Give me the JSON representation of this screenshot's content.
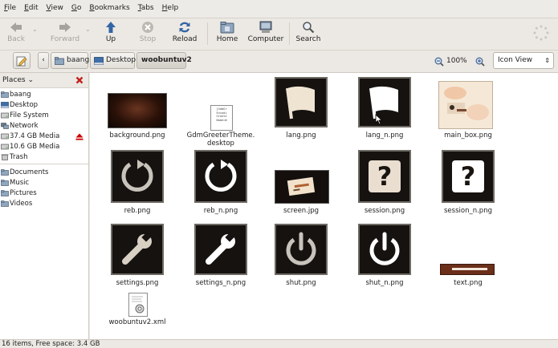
{
  "menubar": [
    {
      "label": "File",
      "key": "F",
      "rest": "ile"
    },
    {
      "label": "Edit",
      "key": "E",
      "rest": "dit"
    },
    {
      "label": "View",
      "key": "V",
      "rest": "iew"
    },
    {
      "label": "Go",
      "key": "G",
      "rest": "o"
    },
    {
      "label": "Bookmarks",
      "key": "B",
      "rest": "ookmarks"
    },
    {
      "label": "Tabs",
      "key": "T",
      "rest": "abs"
    },
    {
      "label": "Help",
      "key": "H",
      "rest": "elp"
    }
  ],
  "toolbar": {
    "back": "Back",
    "forward": "Forward",
    "up": "Up",
    "stop": "Stop",
    "reload": "Reload",
    "home": "Home",
    "computer": "Computer",
    "search": "Search"
  },
  "location": {
    "crumbs": [
      "baang",
      "Desktop",
      "woobuntuv2"
    ],
    "zoom": "100%",
    "view_mode": "Icon View"
  },
  "sidebar": {
    "header": "Places",
    "items": [
      "baang",
      "Desktop",
      "File System",
      "Network",
      "37.4 GB Media",
      "10.6 GB Media",
      "Trash"
    ],
    "bookmarks": [
      "Documents",
      "Music",
      "Pictures",
      "Videos"
    ]
  },
  "files": [
    {
      "name": "background.png",
      "icon": "dark-gradient-thumbnail"
    },
    {
      "name": "GdmGreeterTheme.\ndesktop",
      "icon": "text-document-icon",
      "preview": "[GdmGr\nEncodi\nGreete\nName=W"
    },
    {
      "name": "lang.png",
      "icon": "flag-icon"
    },
    {
      "name": "lang_n.png",
      "icon": "flag-icon"
    },
    {
      "name": "main_box.png",
      "icon": "box-thumbnail"
    },
    {
      "name": "reb.png",
      "icon": "reboot-icon"
    },
    {
      "name": "reb_n.png",
      "icon": "reboot-icon"
    },
    {
      "name": "screen.jpg",
      "icon": "screen-thumbnail"
    },
    {
      "name": "session.png",
      "icon": "question-icon"
    },
    {
      "name": "session_n.png",
      "icon": "question-icon"
    },
    {
      "name": "settings.png",
      "icon": "wrench-icon"
    },
    {
      "name": "settings_n.png",
      "icon": "wrench-icon"
    },
    {
      "name": "shut.png",
      "icon": "power-icon"
    },
    {
      "name": "shut_n.png",
      "icon": "power-icon"
    },
    {
      "name": "text.png",
      "icon": "text-bar-thumbnail"
    },
    {
      "name": "woobuntuv2.xml",
      "icon": "xml-document-icon"
    }
  ],
  "status": "16 items, Free space: 3.4 GB",
  "colors": {
    "tile_dark": "#151210",
    "tile_border": "#6e6a64",
    "accent_blue": "#3465a4",
    "eject_red": "#cc0000"
  }
}
